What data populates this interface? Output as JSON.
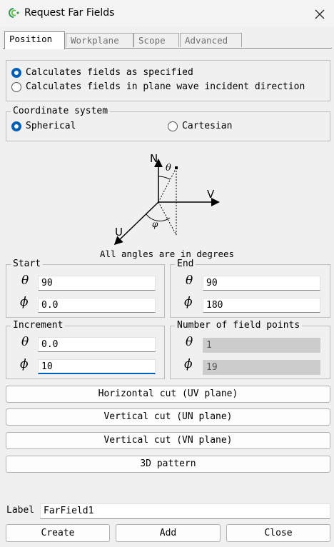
{
  "window": {
    "title": "Request Far Fields",
    "close_icon": "close-icon"
  },
  "tabs": [
    {
      "label": "Position",
      "active": true
    },
    {
      "label": "Workplane",
      "active": false
    },
    {
      "label": "Scope",
      "active": false
    },
    {
      "label": "Advanced",
      "active": false
    }
  ],
  "mode": {
    "option1": "Calculates fields as specified",
    "option2": "Calculates fields in plane wave incident direction",
    "selected": "option1"
  },
  "coordinate_system": {
    "title": "Coordinate system",
    "spherical": "Spherical",
    "cartesian": "Cartesian",
    "selected": "spherical"
  },
  "diagram": {
    "axis_n": "N",
    "axis_v": "V",
    "axis_u": "U",
    "theta": "θ",
    "phi": "φ",
    "note": "All angles are in degrees"
  },
  "start": {
    "title": "Start",
    "theta_label": "θ",
    "phi_label": "ϕ",
    "theta": "90",
    "phi": "0.0"
  },
  "end": {
    "title": "End",
    "theta_label": "θ",
    "phi_label": "ϕ",
    "theta": "90",
    "phi": "180"
  },
  "increment": {
    "title": "Increment",
    "theta_label": "θ",
    "phi_label": "ϕ",
    "theta": "0.0",
    "phi": "10"
  },
  "field_points": {
    "title": "Number of field points",
    "theta_label": "θ",
    "phi_label": "ϕ",
    "theta": "1",
    "phi": "19"
  },
  "presets": {
    "horizontal": "Horizontal cut (UV plane)",
    "vertical_un": "Vertical cut (UN plane)",
    "vertical_vn": "Vertical cut (VN plane)",
    "pattern3d": "3D pattern"
  },
  "label": {
    "caption": "Label",
    "value": "FarField1"
  },
  "actions": {
    "create": "Create",
    "add": "Add",
    "close": "Close"
  },
  "colors": {
    "accent": "#005fb8",
    "app_icon_green": "#2e9e4f"
  }
}
